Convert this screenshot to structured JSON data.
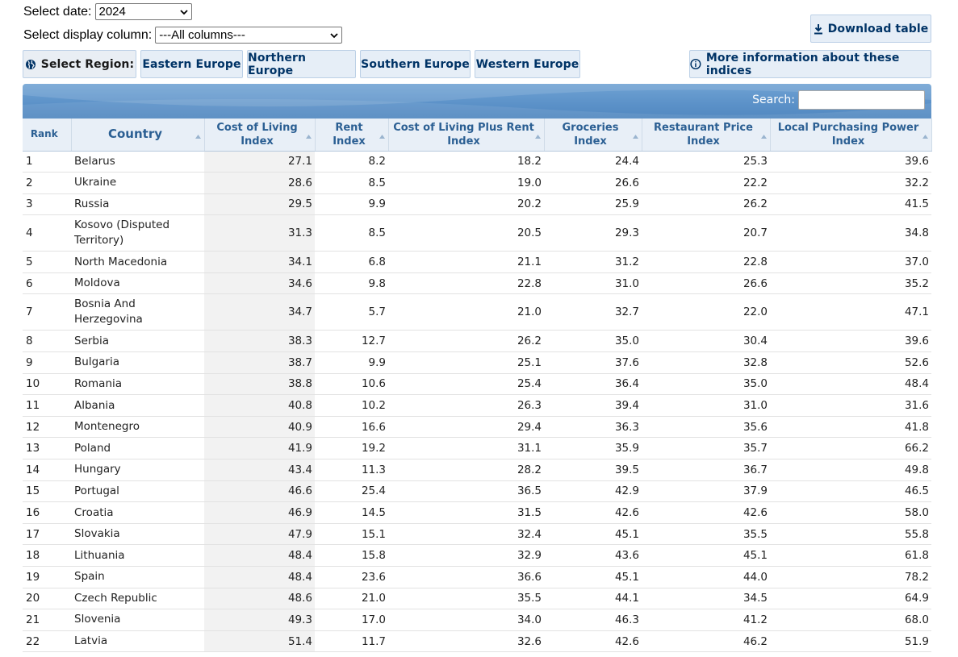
{
  "controls": {
    "date_label": "Select date:",
    "date_value": "2024",
    "column_label": "Select display column:",
    "column_value": "---All columns---"
  },
  "buttons": {
    "download": "Download table",
    "select_region": "Select Region:",
    "regions": [
      "Eastern Europe",
      "Northern Europe",
      "Southern Europe",
      "Western Europe"
    ],
    "more_info": "More information about these indices"
  },
  "search": {
    "label": "Search:",
    "value": ""
  },
  "table": {
    "headers": [
      "Rank",
      "Country",
      "Cost of Living Index",
      "Rent Index",
      "Cost of Living Plus Rent Index",
      "Groceries Index",
      "Restaurant Price Index",
      "Local Purchasing Power Index"
    ],
    "rows": [
      [
        "1",
        "Belarus",
        "27.1",
        "8.2",
        "18.2",
        "24.4",
        "25.3",
        "39.6"
      ],
      [
        "2",
        "Ukraine",
        "28.6",
        "8.5",
        "19.0",
        "26.6",
        "22.2",
        "32.2"
      ],
      [
        "3",
        "Russia",
        "29.5",
        "9.9",
        "20.2",
        "25.9",
        "26.2",
        "41.5"
      ],
      [
        "4",
        "Kosovo (Disputed Territory)",
        "31.3",
        "8.5",
        "20.5",
        "29.3",
        "20.7",
        "34.8"
      ],
      [
        "5",
        "North Macedonia",
        "34.1",
        "6.8",
        "21.1",
        "31.2",
        "22.8",
        "37.0"
      ],
      [
        "6",
        "Moldova",
        "34.6",
        "9.8",
        "22.8",
        "31.0",
        "26.6",
        "35.2"
      ],
      [
        "7",
        "Bosnia And Herzegovina",
        "34.7",
        "5.7",
        "21.0",
        "32.7",
        "22.0",
        "47.1"
      ],
      [
        "8",
        "Serbia",
        "38.3",
        "12.7",
        "26.2",
        "35.0",
        "30.4",
        "39.6"
      ],
      [
        "9",
        "Bulgaria",
        "38.7",
        "9.9",
        "25.1",
        "37.6",
        "32.8",
        "52.6"
      ],
      [
        "10",
        "Romania",
        "38.8",
        "10.6",
        "25.4",
        "36.4",
        "35.0",
        "48.4"
      ],
      [
        "11",
        "Albania",
        "40.8",
        "10.2",
        "26.3",
        "39.4",
        "31.0",
        "31.6"
      ],
      [
        "12",
        "Montenegro",
        "40.9",
        "16.6",
        "29.4",
        "36.3",
        "35.6",
        "41.8"
      ],
      [
        "13",
        "Poland",
        "41.9",
        "19.2",
        "31.1",
        "35.9",
        "35.7",
        "66.2"
      ],
      [
        "14",
        "Hungary",
        "43.4",
        "11.3",
        "28.2",
        "39.5",
        "36.7",
        "49.8"
      ],
      [
        "15",
        "Portugal",
        "46.6",
        "25.4",
        "36.5",
        "42.9",
        "37.9",
        "46.5"
      ],
      [
        "16",
        "Croatia",
        "46.9",
        "14.5",
        "31.5",
        "42.6",
        "42.6",
        "58.0"
      ],
      [
        "17",
        "Slovakia",
        "47.9",
        "15.1",
        "32.4",
        "45.1",
        "35.5",
        "55.8"
      ],
      [
        "18",
        "Lithuania",
        "48.4",
        "15.8",
        "32.9",
        "43.6",
        "45.1",
        "61.8"
      ],
      [
        "19",
        "Spain",
        "48.4",
        "23.6",
        "36.6",
        "45.1",
        "44.0",
        "78.2"
      ],
      [
        "20",
        "Czech Republic",
        "48.6",
        "21.0",
        "35.5",
        "44.1",
        "34.5",
        "64.9"
      ],
      [
        "21",
        "Slovenia",
        "49.3",
        "17.0",
        "34.0",
        "46.3",
        "41.2",
        "68.0"
      ],
      [
        "22",
        "Latvia",
        "51.4",
        "11.7",
        "32.6",
        "42.6",
        "46.2",
        "51.9"
      ]
    ]
  },
  "icons": {
    "download": "download-icon",
    "globe": "globe-icon",
    "info": "info-icon",
    "sort": "sort-arrow-icon",
    "chevron": "chevron-down-icon"
  },
  "colors": {
    "button_bg": "#e6eef7",
    "button_text": "#003366",
    "banner": "#5b91c8",
    "header_text": "#2b5f93",
    "header_bg": "#e8eff7"
  }
}
